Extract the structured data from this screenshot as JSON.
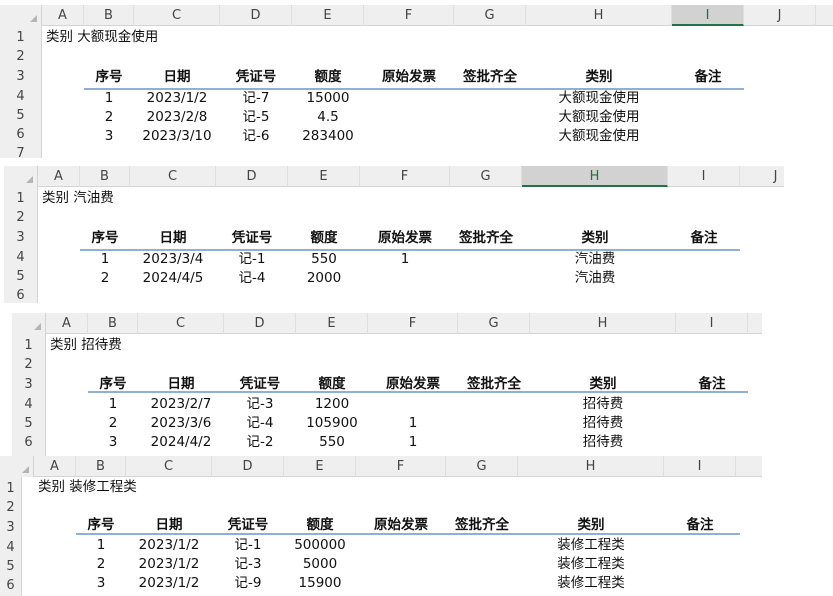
{
  "sheets": [
    {
      "columns": [
        "A",
        "B",
        "C",
        "D",
        "E",
        "F",
        "G",
        "H",
        "I",
        "J"
      ],
      "selected_column": "I",
      "rows": [
        "1",
        "2",
        "3",
        "4",
        "5",
        "6",
        "7"
      ],
      "title": "类别  大额现金使用",
      "headers": [
        "序号",
        "日期",
        "凭证号",
        "额度",
        "原始发票",
        "签批齐全",
        "类别",
        "备注"
      ],
      "data": [
        [
          "1",
          "2023/1/2",
          "记-7",
          "15000",
          "",
          "",
          "大额现金使用",
          ""
        ],
        [
          "2",
          "2023/2/8",
          "记-5",
          "4.5",
          "",
          "",
          "大额现金使用",
          ""
        ],
        [
          "3",
          "2023/3/10",
          "记-6",
          "283400",
          "",
          "",
          "大额现金使用",
          ""
        ]
      ]
    },
    {
      "columns": [
        "A",
        "B",
        "C",
        "D",
        "E",
        "F",
        "G",
        "H",
        "I",
        "J"
      ],
      "selected_column": "H",
      "rows": [
        "1",
        "2",
        "3",
        "4",
        "5",
        "6"
      ],
      "title": "类别  汽油费",
      "headers": [
        "序号",
        "日期",
        "凭证号",
        "额度",
        "原始发票",
        "签批齐全",
        "类别",
        "备注"
      ],
      "data": [
        [
          "1",
          "2023/3/4",
          "记-1",
          "550",
          "1",
          "",
          "汽油费",
          ""
        ],
        [
          "2",
          "2024/4/5",
          "记-4",
          "2000",
          "",
          "",
          "汽油费",
          ""
        ]
      ]
    },
    {
      "columns": [
        "A",
        "B",
        "C",
        "D",
        "E",
        "F",
        "G",
        "H",
        "I"
      ],
      "selected_column": "",
      "rows": [
        "1",
        "2",
        "3",
        "4",
        "5",
        "6"
      ],
      "title": "类别  招待费",
      "headers": [
        "序号",
        "日期",
        "凭证号",
        "额度",
        "原始发票",
        "签批齐全",
        "类别",
        "备注"
      ],
      "data": [
        [
          "1",
          "2023/2/7",
          "记-3",
          "1200",
          "",
          "",
          "招待费",
          ""
        ],
        [
          "2",
          "2023/3/6",
          "记-4",
          "105900",
          "1",
          "",
          "招待费",
          ""
        ],
        [
          "3",
          "2024/4/2",
          "记-2",
          "550",
          "1",
          "",
          "招待费",
          ""
        ]
      ]
    },
    {
      "columns": [
        "A",
        "B",
        "C",
        "D",
        "E",
        "F",
        "G",
        "H",
        "I"
      ],
      "selected_column": "",
      "rows": [
        "1",
        "2",
        "3",
        "4",
        "5",
        "6"
      ],
      "title": "类别  装修工程类",
      "headers": [
        "序号",
        "日期",
        "凭证号",
        "额度",
        "原始发票",
        "签批齐全",
        "类别",
        "备注"
      ],
      "data": [
        [
          "1",
          "2023/1/2",
          "记-1",
          "500000",
          "",
          "",
          "装修工程类",
          ""
        ],
        [
          "2",
          "2023/1/2",
          "记-3",
          "5000",
          "",
          "",
          "装修工程类",
          ""
        ],
        [
          "3",
          "2023/1/2",
          "记-9",
          "15900",
          "",
          "",
          "装修工程类",
          ""
        ]
      ]
    }
  ]
}
